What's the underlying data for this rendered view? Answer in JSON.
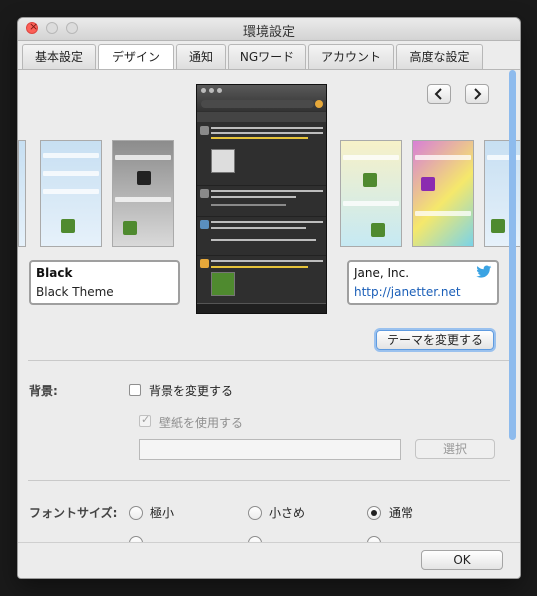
{
  "window": {
    "title": "環境設定"
  },
  "tabs": [
    {
      "label": "基本設定"
    },
    {
      "label": "デザイン"
    },
    {
      "label": "通知"
    },
    {
      "label": "NGワード"
    },
    {
      "label": "アカウント"
    },
    {
      "label": "高度な設定"
    }
  ],
  "active_tab": "デザイン",
  "theme": {
    "selected_name": "Black",
    "selected_description": "Black Theme",
    "author": "Jane, Inc.",
    "author_url": "http://janetter.net",
    "change_button": "テーマを変更する",
    "prev_icon": "chevron-left-icon",
    "next_icon": "chevron-right-icon",
    "author_icon": "twitter-bird-icon"
  },
  "background": {
    "section_label": "背景:",
    "change_checkbox_label": "背景を変更する",
    "change_checked": false,
    "wallpaper_checkbox_label": "壁紙を使用する",
    "wallpaper_checked": true,
    "path_value": "",
    "select_button": "選択"
  },
  "font_size": {
    "section_label": "フォントサイズ:",
    "options": [
      "極小",
      "小さめ",
      "通常"
    ],
    "selected": "通常"
  },
  "footer": {
    "ok_label": "OK"
  },
  "colors": {
    "accent": "#5f9be0",
    "scrollbar": "#8ebbed",
    "link": "#1b5fb8"
  }
}
